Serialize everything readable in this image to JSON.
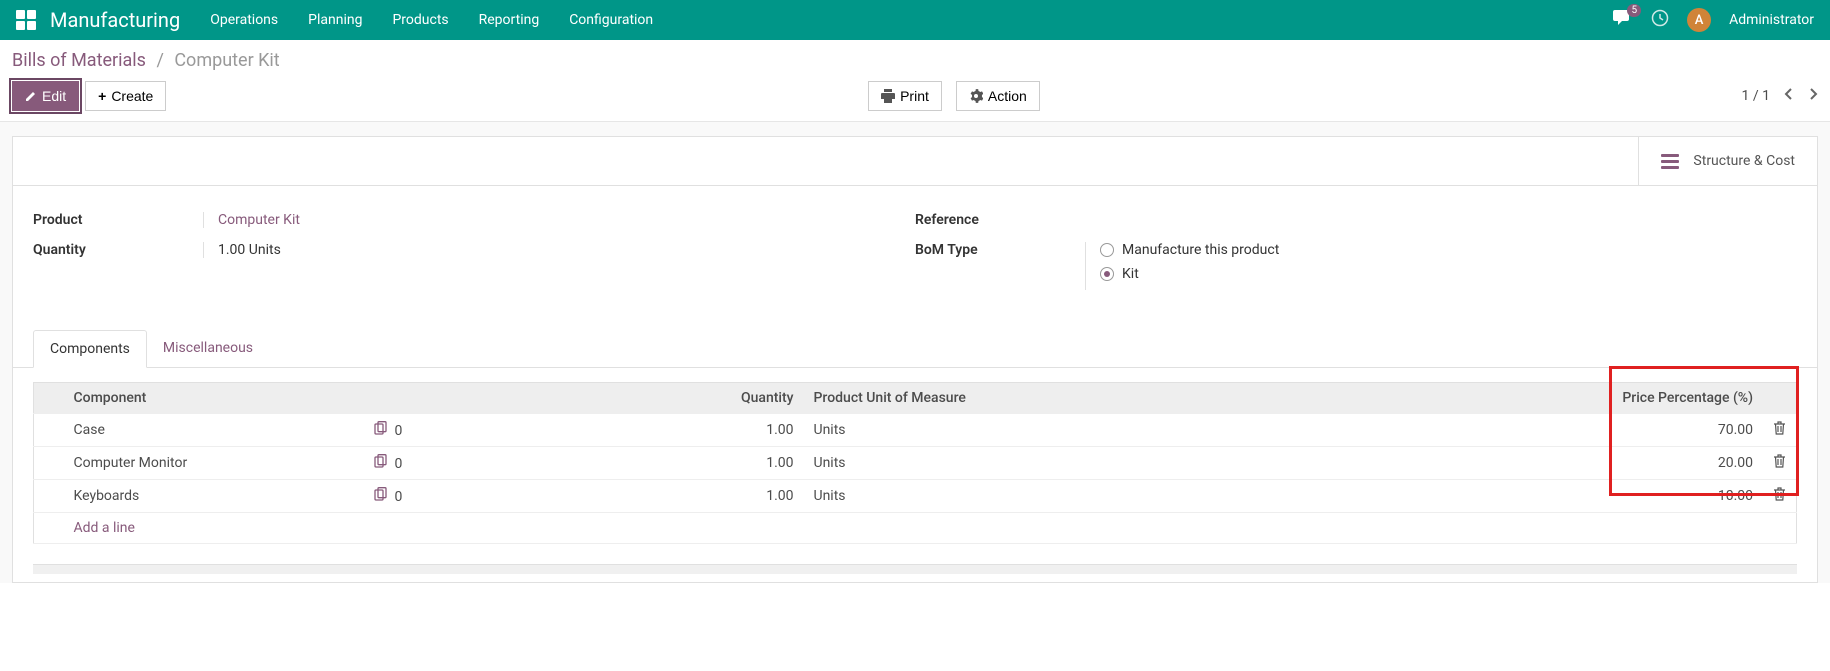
{
  "navbar": {
    "brand": "Manufacturing",
    "menu": [
      "Operations",
      "Planning",
      "Products",
      "Reporting",
      "Configuration"
    ],
    "msg_count": "5",
    "user_initial": "A",
    "user_name": "Administrator"
  },
  "breadcrumb": {
    "root": "Bills of Materials",
    "sep": "/",
    "leaf": "Computer Kit"
  },
  "buttons": {
    "edit": "Edit",
    "create": "Create",
    "print": "Print",
    "action": "Action"
  },
  "pager": {
    "text": "1 / 1"
  },
  "stat_button": {
    "label": "Structure & Cost"
  },
  "form": {
    "product_label": "Product",
    "product_value": "Computer Kit",
    "quantity_label": "Quantity",
    "quantity_value": "1.00",
    "quantity_unit": "Units",
    "reference_label": "Reference",
    "reference_value": "",
    "bom_type_label": "BoM Type",
    "bom_options": {
      "manufacture": "Manufacture this product",
      "kit": "Kit"
    }
  },
  "tabs": {
    "components": "Components",
    "misc": "Miscellaneous"
  },
  "table": {
    "headers": {
      "component": "Component",
      "quantity": "Quantity",
      "uom": "Product Unit of Measure",
      "price_pct": "Price Percentage (%)"
    },
    "rows": [
      {
        "name": "Case",
        "sub": "0",
        "qty": "1.00",
        "uom": "Units",
        "pct": "70.00"
      },
      {
        "name": "Computer Monitor",
        "sub": "0",
        "qty": "1.00",
        "uom": "Units",
        "pct": "20.00"
      },
      {
        "name": "Keyboards",
        "sub": "0",
        "qty": "1.00",
        "uom": "Units",
        "pct": "10.00"
      }
    ],
    "add_line": "Add a line"
  }
}
